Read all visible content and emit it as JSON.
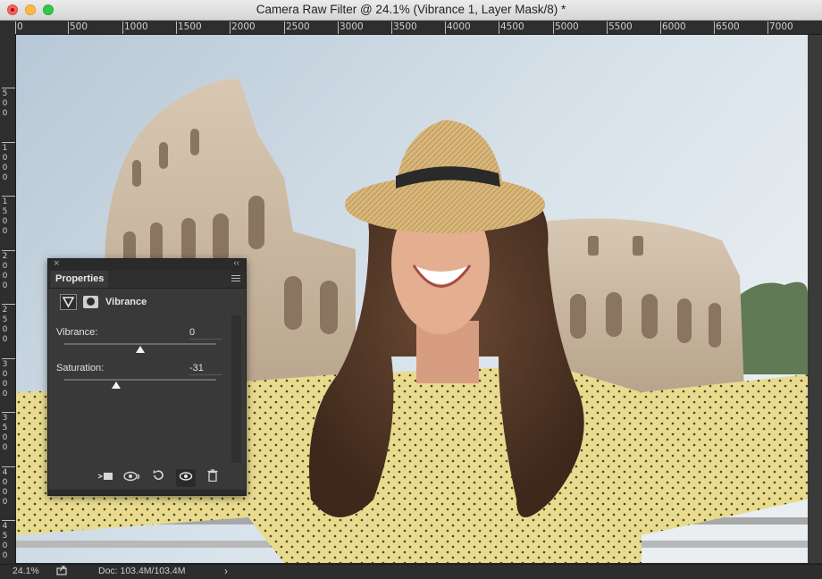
{
  "window": {
    "title": "Camera Raw Filter @ 24.1% (Vibrance 1, Layer Mask/8) *"
  },
  "ruler": {
    "top_labels": [
      "0",
      "500",
      "1000",
      "1500",
      "2000",
      "2500",
      "3000",
      "3500",
      "4000",
      "4500",
      "5000",
      "5500",
      "6000",
      "6500",
      "7000"
    ],
    "left_labels": [
      "5 0 0",
      "1 0 0 0",
      "1 5 0 0",
      "2 0 0 0",
      "2 5 0 0",
      "3 0 0 0",
      "3 5 0 0",
      "4 0 0 0",
      "4 5 0 0"
    ]
  },
  "properties_panel": {
    "tab_label": "Properties",
    "adjustment_name": "Vibrance",
    "vibrance": {
      "label": "Vibrance:",
      "value": "0"
    },
    "saturation": {
      "label": "Saturation:",
      "value": "-31"
    }
  },
  "status_bar": {
    "zoom": "24.1%",
    "doc": "Doc: 103.4M/103.4M",
    "arrow": "›"
  },
  "colors": {
    "sky": "#c9d6df",
    "blouse": "#e6d98a",
    "panel_bg": "#393939"
  }
}
